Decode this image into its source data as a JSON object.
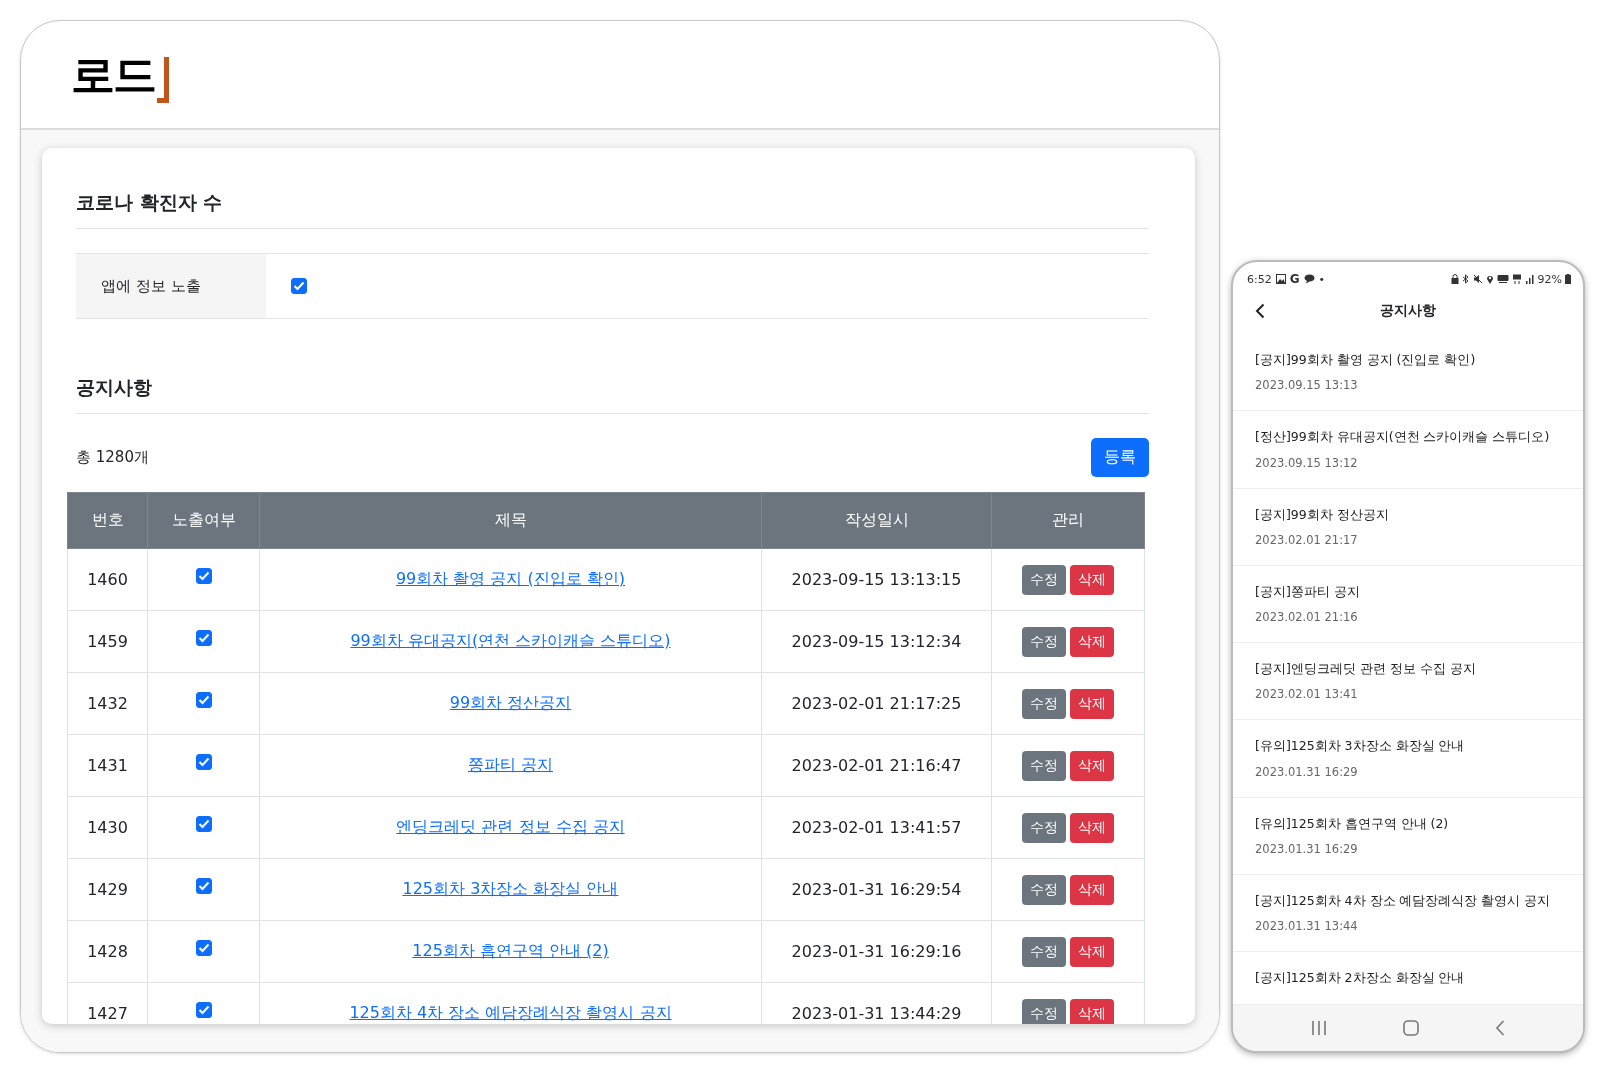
{
  "logo": {
    "text": "로드"
  },
  "covid_section": {
    "title": "코로나 확진자 수",
    "fields": [
      {
        "label": "앱에 정보 노출",
        "kind": "checkbox",
        "checked": true
      }
    ]
  },
  "notice_section": {
    "title": "공지사항",
    "total": "총 1280개",
    "register_button": "등록",
    "table": {
      "columns": [
        "번호",
        "노출여부",
        "제목",
        "작성일시",
        "관리"
      ],
      "rows": [
        {
          "no": "1460",
          "visible": true,
          "title": "99회차 촬영 공지 (진입로 확인)",
          "date": "2023-09-15 13:13:15",
          "edit": "수정",
          "delete": "삭제"
        },
        {
          "no": "1459",
          "visible": true,
          "title": "99회차 유대공지(연천 스카이캐슬 스튜디오)",
          "date": "2023-09-15 13:12:34",
          "edit": "수정",
          "delete": "삭제"
        },
        {
          "no": "1432",
          "visible": true,
          "title": "99회차 정산공지",
          "date": "2023-02-01 21:17:25",
          "edit": "수정",
          "delete": "삭제"
        },
        {
          "no": "1431",
          "visible": true,
          "title": "쫑파티 공지",
          "date": "2023-02-01 21:16:47",
          "edit": "수정",
          "delete": "삭제"
        },
        {
          "no": "1430",
          "visible": true,
          "title": "엔딩크레딧 관련 정보 수집 공지",
          "date": "2023-02-01 13:41:57",
          "edit": "수정",
          "delete": "삭제"
        },
        {
          "no": "1429",
          "visible": true,
          "title": "125회차 3차장소 화장실 안내",
          "date": "2023-01-31 16:29:54",
          "edit": "수정",
          "delete": "삭제"
        },
        {
          "no": "1428",
          "visible": true,
          "title": "125회차 흡연구역 안내 (2)",
          "date": "2023-01-31 16:29:16",
          "edit": "수정",
          "delete": "삭제"
        },
        {
          "no": "1427",
          "visible": true,
          "title": "125회차 4차 장소 예담장례식장 촬영시 공지",
          "date": "2023-01-31 13:44:29",
          "edit": "수정",
          "delete": "삭제"
        }
      ]
    }
  },
  "phone": {
    "status_bar": {
      "time": "6:52",
      "app_letter": "G",
      "dot": "•",
      "battery": "92%"
    },
    "title": "공지사항",
    "items": [
      {
        "title": "[공지]99회차 촬영 공지 (진입로 확인)",
        "date": "2023.09.15 13:13"
      },
      {
        "title": "[정산]99회차 유대공지(연천 스카이캐슬 스튜디오)",
        "date": "2023.09.15 13:12"
      },
      {
        "title": "[공지]99회차 정산공지",
        "date": "2023.02.01 21:17"
      },
      {
        "title": "[공지]쫑파티 공지",
        "date": "2023.02.01 21:16"
      },
      {
        "title": "[공지]엔딩크레딧 관련 정보 수집 공지",
        "date": "2023.02.01 13:41"
      },
      {
        "title": "[유의]125회차 3차장소 화장실 안내",
        "date": "2023.01.31 16:29"
      },
      {
        "title": "[유의]125회차 흡연구역 안내 (2)",
        "date": "2023.01.31 16:29"
      },
      {
        "title": "[공지]125회차 4차 장소 예담장례식장 촬영시 공지",
        "date": "2023.01.31 13:44"
      },
      {
        "title": "[공지]125회차 2차장소 화장실 안내"
      }
    ]
  }
}
